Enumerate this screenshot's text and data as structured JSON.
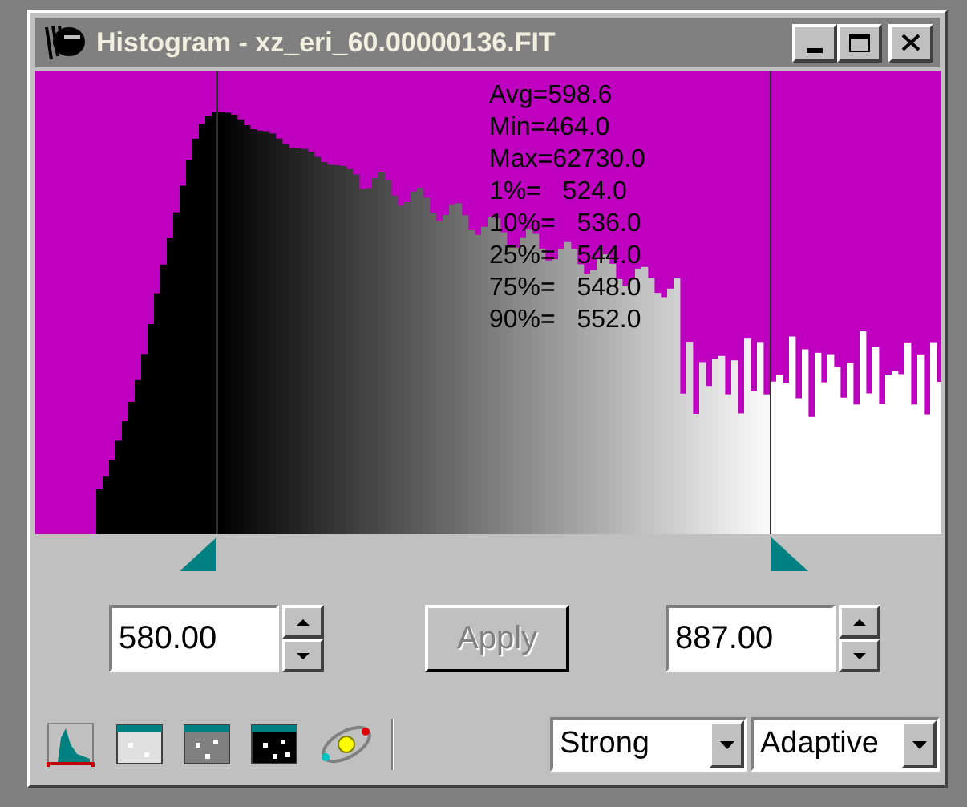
{
  "window": {
    "title": "Histogram - xz_eri_60.00000136.FIT"
  },
  "stats": [
    "Avg=598.6",
    "Min=464.0",
    "Max=62730.0",
    "1%=   524.0",
    "10%=   536.0",
    "25%=   544.0",
    "75%=   548.0",
    "90%=   552.0"
  ],
  "markers": [
    {
      "kind": "low",
      "level": 0.2
    },
    {
      "kind": "high",
      "level": 0.812
    }
  ],
  "low_field": {
    "value": "580.00"
  },
  "apply_button": {
    "label": "Apply",
    "disabled": true
  },
  "high_field": {
    "value": "887.00"
  },
  "toolbar": [
    {
      "kind": "histogram"
    },
    {
      "kind": "light"
    },
    {
      "kind": "medium"
    },
    {
      "kind": "dark"
    },
    {
      "kind": "orbit"
    }
  ],
  "dropdowns": [
    {
      "value": "Strong"
    },
    {
      "value": "Adaptive"
    }
  ]
}
